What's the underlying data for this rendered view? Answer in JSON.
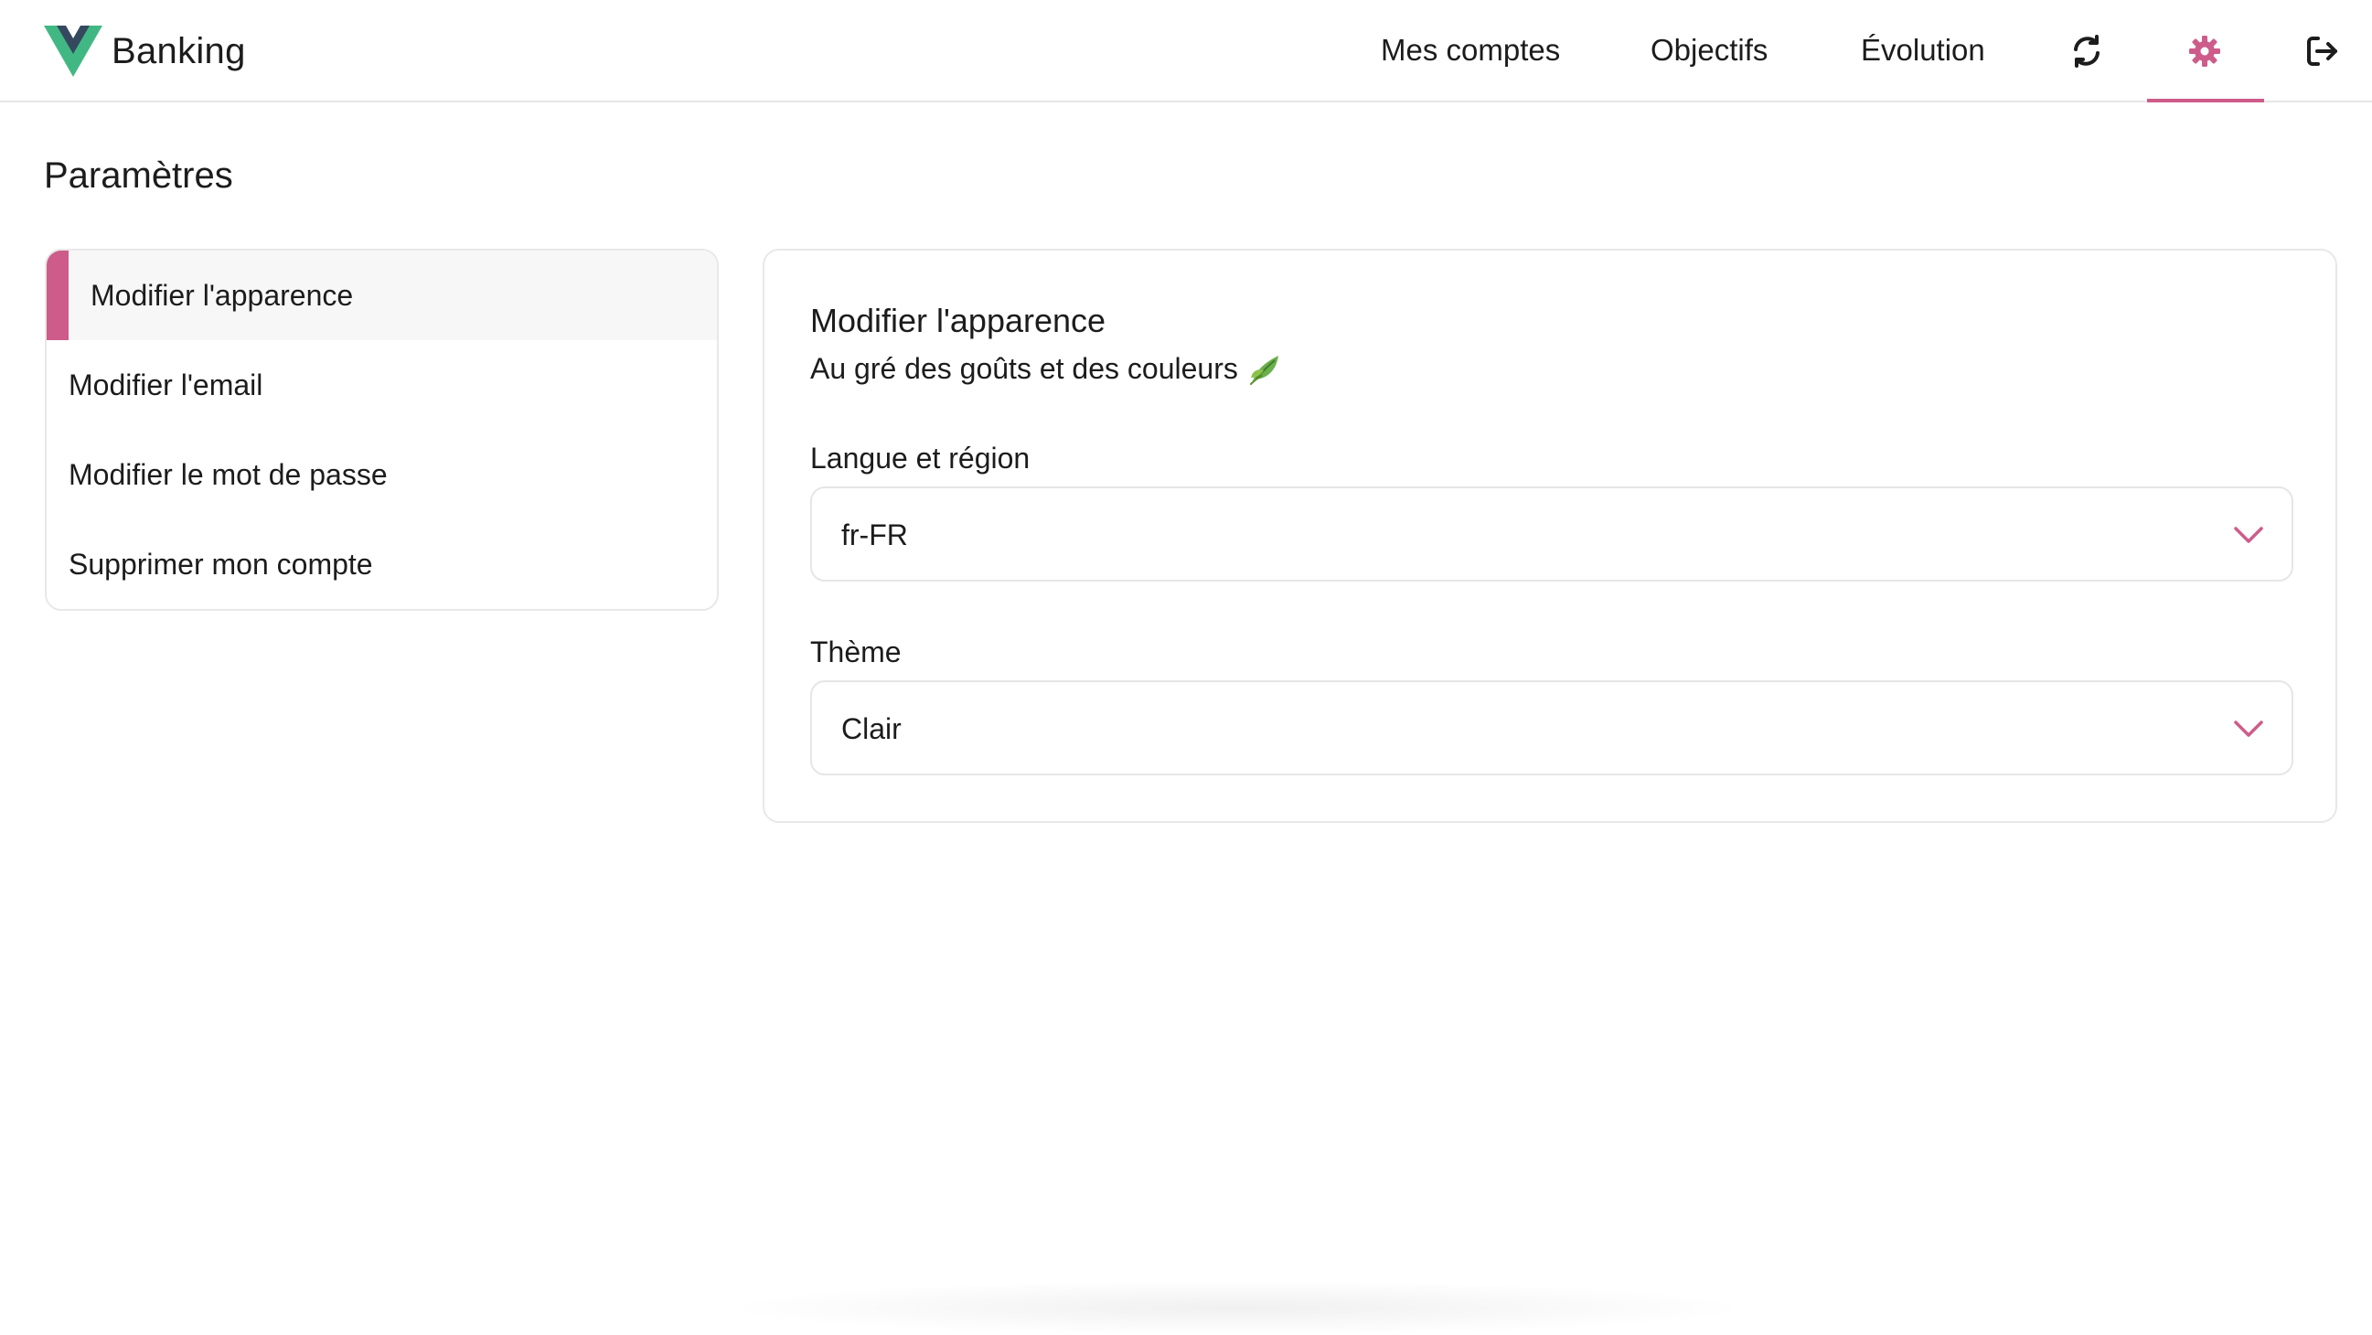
{
  "brand": {
    "name": "Banking",
    "logo_colors": {
      "outer": "#41b883",
      "inner": "#35495e"
    }
  },
  "nav": {
    "links": [
      {
        "label": "Mes comptes"
      },
      {
        "label": "Objectifs"
      },
      {
        "label": "Évolution"
      }
    ],
    "icons": [
      {
        "name": "refresh-icon",
        "active": false
      },
      {
        "name": "gear-icon",
        "active": true
      },
      {
        "name": "logout-icon",
        "active": false
      }
    ]
  },
  "page": {
    "title": "Paramètres"
  },
  "sidebar": {
    "items": [
      {
        "label": "Modifier l'apparence",
        "active": true
      },
      {
        "label": "Modifier l'email",
        "active": false
      },
      {
        "label": "Modifier le mot de passe",
        "active": false
      },
      {
        "label": "Supprimer mon compte",
        "active": false
      }
    ]
  },
  "panel": {
    "title": "Modifier l'apparence",
    "subtitle": "Au gré des goûts et des couleurs",
    "subtitle_icon": "leaf-icon",
    "fields": [
      {
        "label": "Langue et région",
        "value": "fr-FR"
      },
      {
        "label": "Thème",
        "value": "Clair"
      }
    ]
  },
  "colors": {
    "accent": "#cd5c8a",
    "border": "#e8e8e8",
    "active_bg": "#f7f7f7",
    "text": "#1c1c1c"
  }
}
